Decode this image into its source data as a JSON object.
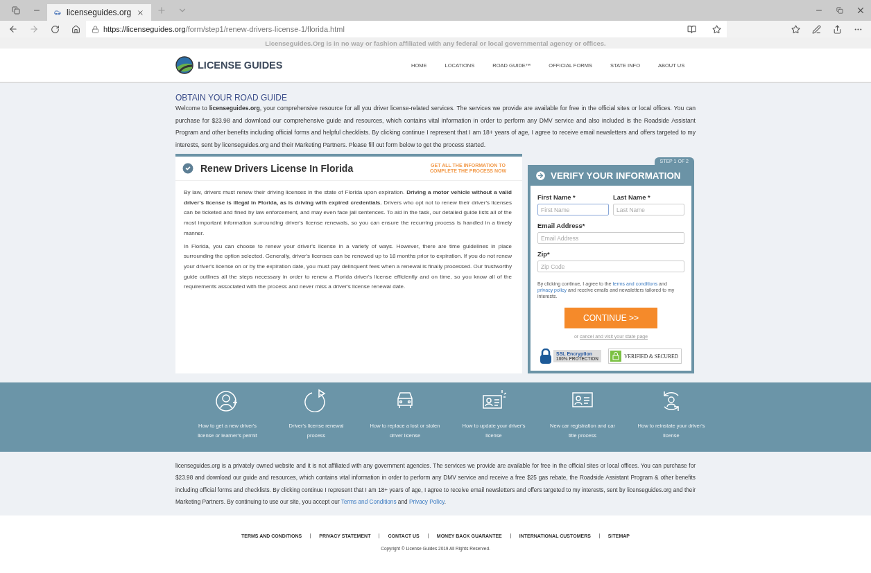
{
  "browser": {
    "tab_title": "licenseguides.org",
    "url_host": "https://licenseguides.org",
    "url_path": "/form/step1/renew-drivers-license-1/florida.html"
  },
  "notice": "Licenseguides.Org is in no way or fashion affiliated with any federal or local governmental agency or offices.",
  "nav": {
    "logo": "LICENSE GUIDES",
    "items": [
      "HOME",
      "LOCATIONS",
      "ROAD GUIDE™",
      "OFFICIAL FORMS",
      "STATE INFO",
      "ABOUT US"
    ]
  },
  "intro": {
    "heading": "OBTAIN YOUR ROAD GUIDE",
    "text": "Welcome to **licenseguides.org**, your comprehensive resource for all you driver license-related services. The services we provide are available for free in the official sites or local offices. You can purchase for $23.98 and download our comprehensive guide and resources, which contains vital information in order to perform any DMV service and also included is the Roadside Assistant Program and other benefits including official forms and helpful checklists. By clicking continue I represent that I am 18+ years of age, I agree to receive email newsletters and offers targeted to my interests, sent by licenseguides.org and their Marketing Partners. Please fill out form below to get the process started."
  },
  "article": {
    "title": "Renew Drivers License In Florida",
    "tagline": "GET ALL THE INFORMATION TO COMPLETE THE PROCESS NOW",
    "paragraphs": [
      "By law, drivers must renew their driving licenses in the state of Florida upon expiration. **Driving a motor vehicle without a valid driver's license is illegal in Florida, as is driving with expired credentials.** Drivers who opt not to renew their driver's licenses can be ticketed and fined by law enforcement, and may even face jail sentences. To aid in the task, our detailed guide lists all of the most important information surrounding driver's license renewals, so you can ensure the recurring process is handled in a timely manner.",
      "In Florida, you can choose to renew your driver's license in a variety of ways. However, there are time guidelines in place surrounding the option selected. Generally, driver's licenses can be renewed up to 18 months prior to expiration. If you do not renew your driver's license on or by the expiration date, you must pay delinquent fees when a renewal is finally processed. Our trustworthy guide outlines all the steps necessary in order to renew a Florida driver's license efficiently and on time, so you know all of the requirements associated with the process and never miss a driver's license renewal date."
    ]
  },
  "form": {
    "step": "STEP 1 OF 2",
    "title": "VERIFY YOUR INFORMATION",
    "fields": [
      {
        "kind": "half",
        "label": "First Name *",
        "placeholder": "First Name",
        "focused": true
      },
      {
        "kind": "half",
        "label": "Last Name *",
        "placeholder": "Last Name",
        "focused": false
      },
      {
        "kind": "full",
        "label": "Email Address*",
        "placeholder": "Email Address",
        "focused": false
      },
      {
        "kind": "full",
        "label": "Zip*",
        "placeholder": "Zip Code",
        "focused": false
      }
    ],
    "consent": [
      {
        "kind": "text",
        "text": "By clicking continue, I agree to the "
      },
      {
        "kind": "link",
        "text": "terms and conditions"
      },
      {
        "kind": "text",
        "text": " and "
      },
      {
        "kind": "link",
        "text": "privacy policy"
      },
      {
        "kind": "text",
        "text": " and receive emails and newsletters tailored to my interests."
      }
    ],
    "button": "CONTINUE >>",
    "cancel": [
      {
        "kind": "text",
        "text": "or "
      },
      {
        "kind": "link",
        "text": "cancel and visit your state page"
      }
    ],
    "badges": [
      {
        "kind": "ssl",
        "title": "SSL Encryption",
        "subtitle": "100% PROTECTION"
      },
      {
        "kind": "verified",
        "title": "VERIFIED & SECURED"
      }
    ]
  },
  "services": [
    {
      "label": "How to get a new driver's license or learner's permit"
    },
    {
      "label": "Driver's license renewal process"
    },
    {
      "label": "How to replace a lost or stolen driver license"
    },
    {
      "label": "How to update your driver's license"
    },
    {
      "label": "New car registration and car title process"
    },
    {
      "label": "How to reinstate your driver's license"
    }
  ],
  "disclaimer": [
    {
      "kind": "text",
      "text": "licenseguides.org is a privately owned website and it is not affiliated with any government agencies. The services we provide are available for free in the official sites or local offices. You can purchase for $23.98 and download our guide and resources, which contains vital information in order to perform any DMV service and receive a free $25 gas rebate, the Roadside Assistant Program & other benefits including official forms and checklists. By clicking continue I represent that I am 18+ years of age, I agree to receive email newsletters and offers targeted to my interests, sent by licenseguides.org and their Marketing Partners. By continuing to use our site, you accept our "
    },
    {
      "kind": "link",
      "text": "Terms and Conditions"
    },
    {
      "kind": "text",
      "text": " and "
    },
    {
      "kind": "link",
      "text": "Privacy Policy"
    },
    {
      "kind": "text",
      "text": "."
    }
  ],
  "footer_links": [
    "TERMS AND CONDITIONS",
    "PRIVACY STATEMENT",
    "CONTACT US",
    "MONEY BACK GUARANTEE",
    "INTERNATIONAL CUSTOMERS",
    "SITEMAP"
  ],
  "copyright": "Copyright © License Guides 2019 All Rights Reserved."
}
